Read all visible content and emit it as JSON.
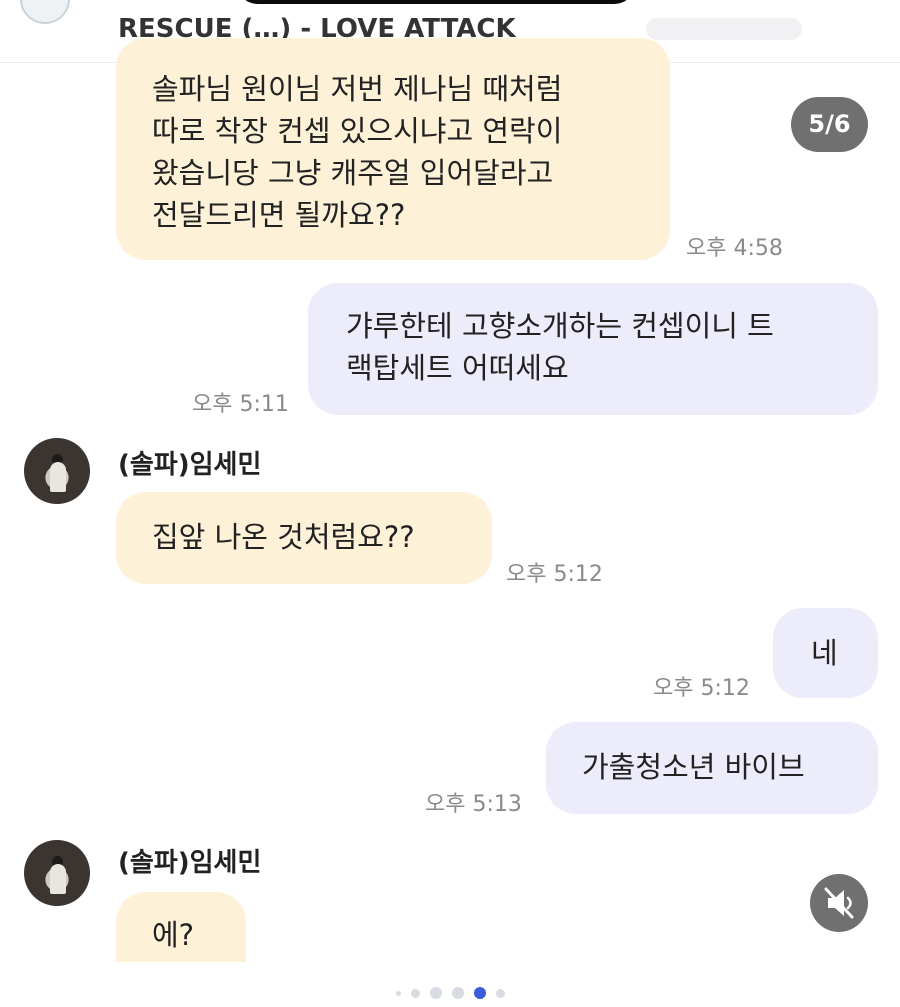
{
  "header": {
    "title": "RESCUE (…) - LOVE ATTACK"
  },
  "counter": "5/6",
  "messages": [
    {
      "direction": "in",
      "lines": [
        "솔파님 원이님 저번 제나님 때처럼",
        "따로 착장 컨셉 있으시냐고 연락이",
        "왔습니당 그냥 캐주얼 입어달라고",
        "전달드리면 될까요??"
      ],
      "time": "오후 4:58"
    },
    {
      "direction": "out",
      "lines": [
        "갸루한테 고향소개하는 컨셉이니 트",
        "랙탑세트 어떠세요"
      ],
      "time": "오후 5:11"
    },
    {
      "direction": "in",
      "sender": "(솔파)임세민",
      "lines": [
        "집앞 나온 것처럼요??"
      ],
      "time": "오후 5:12"
    },
    {
      "direction": "out",
      "lines": [
        "네"
      ],
      "time": "오후 5:12"
    },
    {
      "direction": "out",
      "lines": [
        "가출청소년 바이브"
      ],
      "time": "오후 5:13"
    },
    {
      "direction": "in",
      "sender": "(솔파)임세민",
      "lines": [
        "에?"
      ],
      "time": ""
    }
  ],
  "pagination": {
    "count": 6,
    "active_index": 4
  },
  "icons": {
    "mute": "speaker-muted-icon"
  },
  "colors": {
    "incoming_bubble": "#fdf1d8",
    "outgoing_bubble": "#ececfa",
    "active_dot": "#3b5bdb"
  }
}
